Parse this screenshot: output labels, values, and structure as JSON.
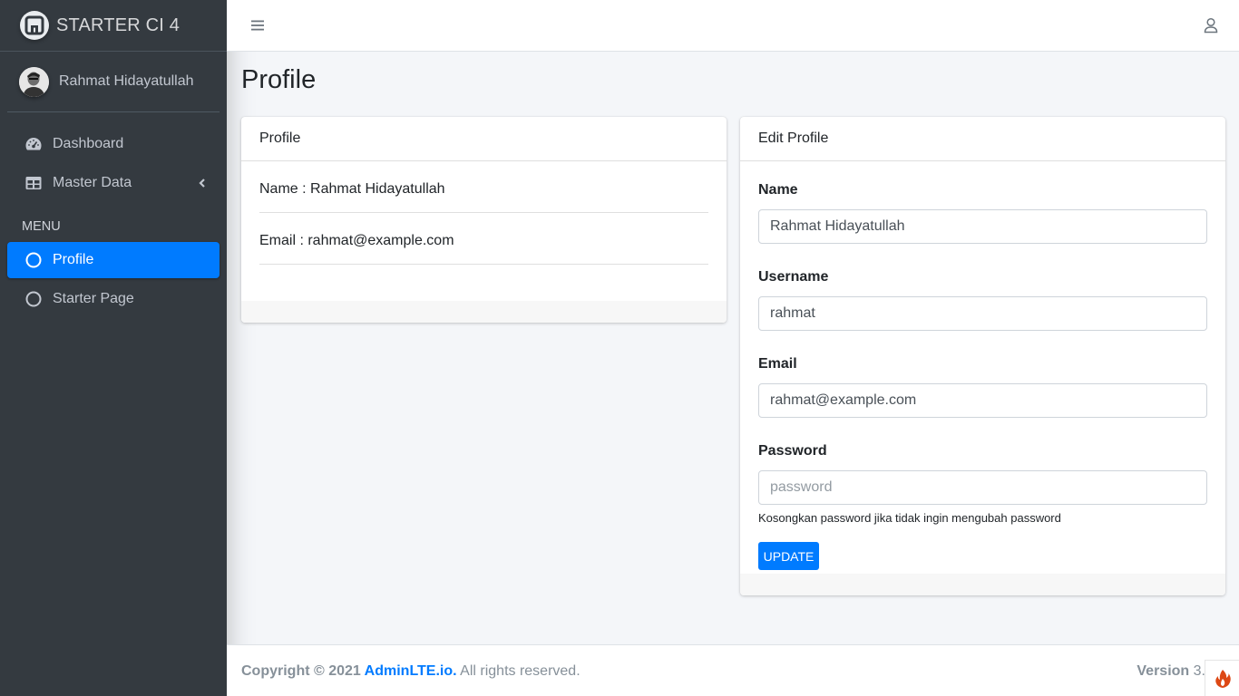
{
  "brand": {
    "name": "STARTER CI 4",
    "logo_icon": "adminlte-logo-icon"
  },
  "user": {
    "name": "Rahmat Hidayatullah",
    "avatar_icon": "avatar-photo"
  },
  "sidebar": {
    "items": [
      {
        "label": "Dashboard",
        "icon": "tachometer-icon"
      },
      {
        "label": "Master Data",
        "icon": "table-icon"
      }
    ],
    "header": "MENU",
    "menu_items": [
      {
        "label": "Profile",
        "icon": "circle-icon",
        "active": true
      },
      {
        "label": "Starter Page",
        "icon": "circle-icon",
        "active": false
      }
    ]
  },
  "page": {
    "title": "Profile"
  },
  "profile_card": {
    "header": "Profile",
    "name_row": "Name : Rahmat Hidayatullah",
    "email_row": "Email : rahmat@example.com"
  },
  "edit_card": {
    "header": "Edit Profile",
    "name_label": "Name",
    "name_value": "Rahmat Hidayatullah",
    "username_label": "Username",
    "username_value": "rahmat",
    "email_label": "Email",
    "email_value": "rahmat@example.com",
    "password_label": "Password",
    "password_placeholder": "password",
    "password_help": "Kosongkan password jika tidak ingin mengubah password",
    "update_label": "UPDATE"
  },
  "footer": {
    "copyright_prefix": "Copyright © 2021 ",
    "link_text": "AdminLTE.io.",
    "suffix": " All rights reserved.",
    "version_label": "Version",
    "version_value": " 3."
  },
  "colors": {
    "primary": "#007bff",
    "sidebar_bg": "#343a40",
    "content_bg": "#f4f6f9"
  }
}
